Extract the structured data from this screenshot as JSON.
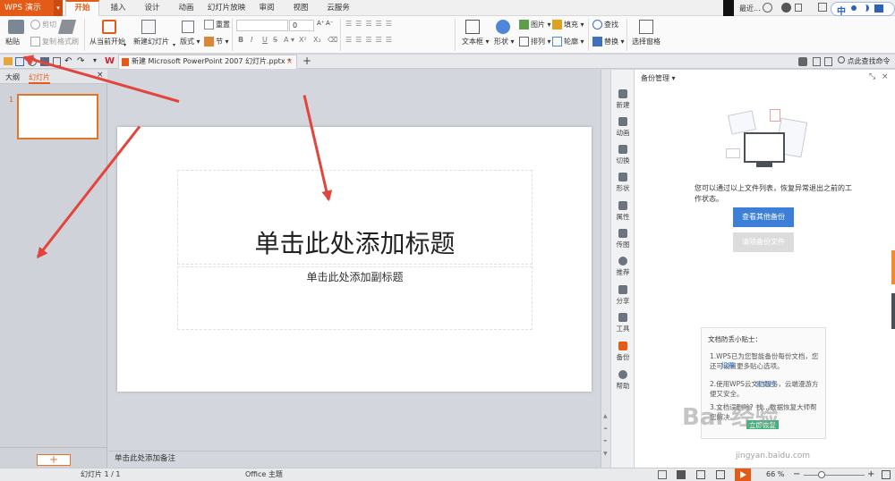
{
  "app": {
    "name": "WPS 演示"
  },
  "menu_tabs": [
    "开始",
    "插入",
    "设计",
    "动画",
    "幻灯片放映",
    "审阅",
    "视图",
    "云服务"
  ],
  "active_tab": "开始",
  "window": {
    "recent": "最近..."
  },
  "ribbon": {
    "paste": "粘贴",
    "cut": "剪切",
    "copy": "复制",
    "format_painter": "格式刷",
    "from_current": "从当前开始",
    "new_slide": "新建幻灯片",
    "layout": "版式",
    "section": "节",
    "reset": "重置",
    "font_name": "",
    "font_size": "0",
    "text_box": "文本框",
    "shape": "形状",
    "picture": "图片",
    "fill": "填充",
    "arrange": "排列",
    "outline": "轮廓",
    "find": "查找",
    "replace": "替换",
    "select_pane": "选择窗格",
    "bold": "B",
    "italic": "I",
    "underline": "U",
    "font_color": "A",
    "superscript": "X²",
    "subscript": "X₂",
    "search_cmd": "点此查找命令"
  },
  "doc_tab": {
    "title": "新建 Microsoft PowerPoint 2007 幻灯片.pptx *",
    "close": "×",
    "add": "+"
  },
  "left_pane": {
    "tab_outline": "大纲",
    "tab_slides": "幻灯片",
    "close": "×",
    "slide_number": "1",
    "add_button": "+"
  },
  "slide": {
    "title_placeholder": "单击此处添加标题",
    "subtitle_placeholder": "单击此处添加副标题"
  },
  "notes_placeholder": "单击此处添加备注",
  "sidebar": [
    "新建",
    "动画",
    "切换",
    "形状",
    "属性",
    "传图",
    "推荐",
    "分享",
    "工具",
    "备份",
    "帮助"
  ],
  "backup_panel": {
    "title": "备份管理",
    "description": "您可以通过以上文件列表，恢复异常退出之前的工作状态。",
    "view_other_button": "查看其他备份",
    "clear_button": "清除备份文件",
    "tips_title": "文档防丢小贴士：",
    "tip1": "1.WPS已为您智能备份每份文档，您还可设置更多贴心选项。",
    "tip1_link": "设置",
    "tip2": "2.使用WPS云文档服务，云端漫游方便又安全。",
    "tip2_link": "云文档",
    "tip3": "3.文档误删除？找…数据恢复大师帮您解决。",
    "tip3_link": "立即恢复",
    "accent": "#3d7fd6"
  },
  "status": {
    "slide_info": "幻灯片 1 / 1",
    "theme": "Office 主题",
    "zoom": "66 %"
  },
  "watermark": {
    "brand": "Bai 经验",
    "url": "jingyan.baidu.com"
  },
  "colors": {
    "brand": "#e45b17",
    "annotation_arrow": "#e3443c",
    "primary_button": "#3d7fd6"
  }
}
